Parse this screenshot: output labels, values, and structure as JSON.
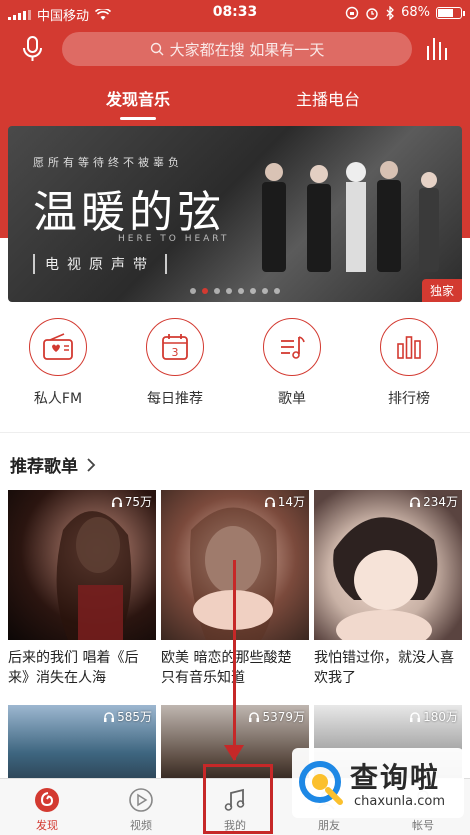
{
  "status_bar": {
    "carrier": "中国移动",
    "time": "08:33",
    "battery": "68%",
    "battery_level": 0.68
  },
  "header": {
    "search_placeholder": "大家都在搜 如果有一天"
  },
  "tabs": [
    {
      "label": "发现音乐",
      "active": true
    },
    {
      "label": "主播电台",
      "active": false
    }
  ],
  "banner": {
    "subtitle": "愿所有等待终不被辜负",
    "title": "温暖的弦",
    "english": "HERE TO HEART",
    "caption": "电视原声带",
    "badge": "独家",
    "dot_count": 8,
    "active_dot": 1
  },
  "quick_entries": [
    {
      "label": "私人FM",
      "icon": "radio-icon"
    },
    {
      "label": "每日推荐",
      "icon": "calendar-icon"
    },
    {
      "label": "歌单",
      "icon": "playlist-icon"
    },
    {
      "label": "排行榜",
      "icon": "chart-icon"
    }
  ],
  "section": {
    "title": "推荐歌单"
  },
  "playlists": [
    {
      "plays": "75万",
      "desc": "后来的我们 唱着《后来》消失在人海"
    },
    {
      "plays": "14万",
      "desc": "欧美 暗恋的那些酸楚 只有音乐知道"
    },
    {
      "plays": "234万",
      "desc": "我怕错过你，就没人喜欢我了"
    },
    {
      "plays": "585万",
      "desc": ""
    },
    {
      "plays": "5379万",
      "desc": ""
    },
    {
      "plays": "180万",
      "desc": ""
    }
  ],
  "bottom_nav": [
    {
      "label": "发现",
      "icon": "netease-music-icon",
      "active": true
    },
    {
      "label": "视频",
      "icon": "video-icon",
      "active": false
    },
    {
      "label": "我的",
      "icon": "music-note-icon",
      "active": false
    },
    {
      "label": "朋友",
      "icon": "friends-icon",
      "active": false
    },
    {
      "label": "帐号",
      "icon": "account-icon",
      "active": false
    }
  ],
  "watermark": {
    "cn": "查询啦",
    "en": "chaxunla.com"
  },
  "colors": {
    "brand_red": "#d33a31",
    "highlight": "#c62828"
  }
}
